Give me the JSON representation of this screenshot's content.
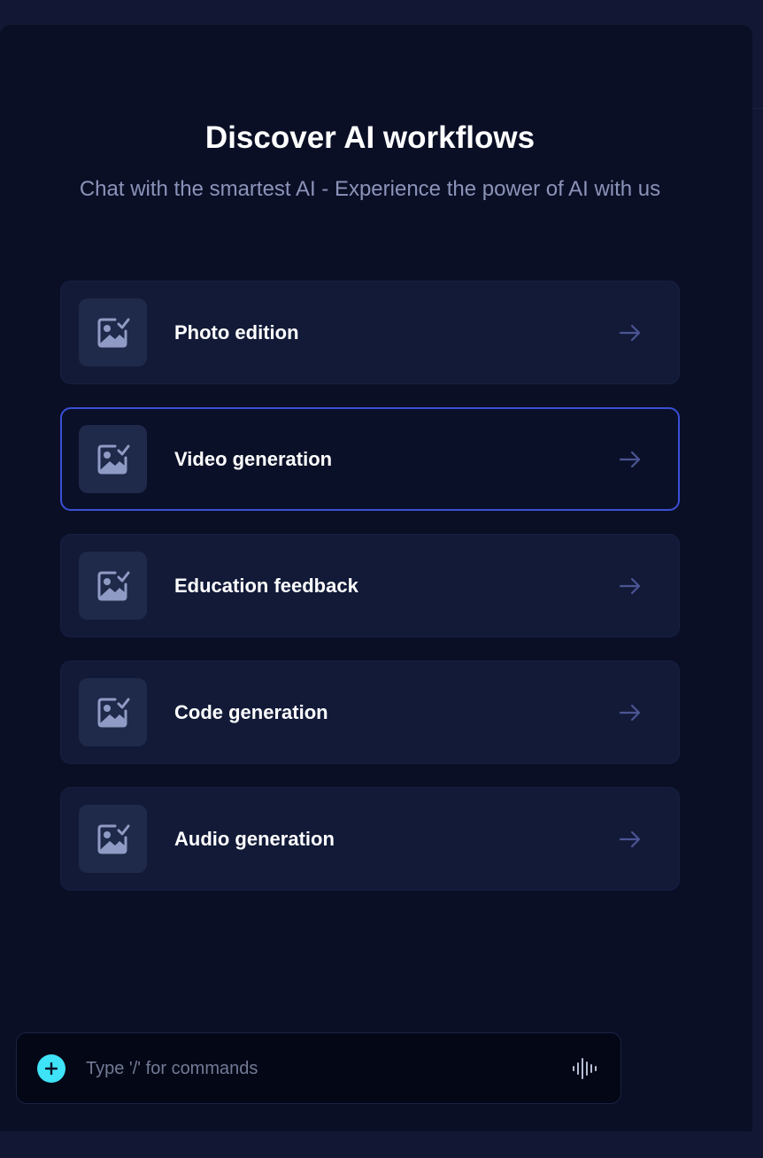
{
  "header": {
    "title": "Discover AI workflows",
    "subtitle": "Chat with the smartest AI - Experience the power of AI with us"
  },
  "workflows": [
    {
      "label": "Photo edition",
      "icon": "image-check-icon",
      "active": false
    },
    {
      "label": "Video generation",
      "icon": "image-check-icon",
      "active": true
    },
    {
      "label": "Education feedback",
      "icon": "image-check-icon",
      "active": false
    },
    {
      "label": "Code generation",
      "icon": "image-check-icon",
      "active": false
    },
    {
      "label": "Audio generation",
      "icon": "image-check-icon",
      "active": false
    }
  ],
  "composer": {
    "placeholder": "Type '/' for commands",
    "value": "",
    "add_icon": "plus-icon",
    "voice_icon": "waveform-icon"
  },
  "colors": {
    "background": "#0a0f26",
    "card": "#121a38",
    "active_border": "#3a4fd6",
    "accent": "#3ee3f7",
    "icon": "#8f9bc4"
  }
}
